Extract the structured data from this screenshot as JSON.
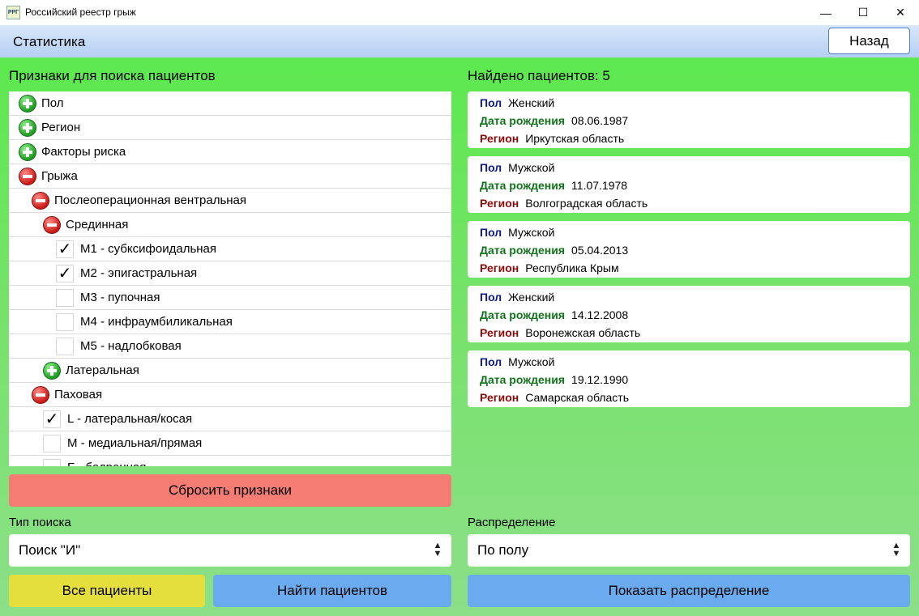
{
  "window": {
    "icon_text": "РРГ",
    "title": "Российский реестр грыж",
    "minimize_glyph": "—",
    "maximize_glyph": "☐",
    "close_glyph": "✕"
  },
  "header": {
    "title": "Статистика",
    "back_label": "Назад"
  },
  "left": {
    "section_title": "Признаки для поиска пациентов",
    "tree": [
      {
        "label": "Пол",
        "type": "plus"
      },
      {
        "label": "Регион",
        "type": "plus"
      },
      {
        "label": "Факторы риска",
        "type": "plus"
      },
      {
        "label": "Грыжа",
        "type": "minus"
      },
      {
        "label": "Послеоперационная вентральная",
        "type": "minus"
      },
      {
        "label": "Срединная",
        "type": "minus"
      },
      {
        "label": "M1 - субксифоидальная",
        "type": "check",
        "checked": true
      },
      {
        "label": "M2 - эпигастральная",
        "type": "check",
        "checked": true
      },
      {
        "label": "M3 - пупочная",
        "type": "check",
        "checked": false
      },
      {
        "label": "M4 - инфраумбиликальная",
        "type": "check",
        "checked": false
      },
      {
        "label": "M5 - надлобковая",
        "type": "check",
        "checked": false
      },
      {
        "label": "Латеральная",
        "type": "plus"
      },
      {
        "label": "Паховая",
        "type": "minus"
      },
      {
        "label": "L - латеральная/косая",
        "type": "check",
        "checked": true
      },
      {
        "label": "M - медиальная/прямая",
        "type": "check",
        "checked": false
      },
      {
        "label": "F - бедренная",
        "type": "check",
        "checked": false
      }
    ],
    "reset_label": "Сбросить признаки",
    "search_type_label": "Тип поиска",
    "search_type_value": "Поиск \"И\"",
    "all_patients_label": "Все пациенты",
    "find_patients_label": "Найти пациентов"
  },
  "right": {
    "found_label": "Найдено пациентов: 5",
    "field_labels": {
      "sex": "Пол",
      "birth": "Дата рождения",
      "region": "Регион"
    },
    "patients": [
      {
        "sex": "Женский",
        "birth": "08.06.1987",
        "region": "Иркутская область"
      },
      {
        "sex": "Мужской",
        "birth": "11.07.1978",
        "region": "Волгоградская область"
      },
      {
        "sex": "Мужской",
        "birth": "05.04.2013",
        "region": "Республика Крым"
      },
      {
        "sex": "Женский",
        "birth": "14.12.2008",
        "region": "Воронежская область"
      },
      {
        "sex": "Мужской",
        "birth": "19.12.1990",
        "region": "Самарская область"
      }
    ],
    "distribution_label": "Распределение",
    "distribution_value": "По полу",
    "show_distribution_label": "Показать распределение"
  },
  "colors": {
    "header_bg": "#b6cff5",
    "panel_bg": "#5de94f",
    "reset_button": "#f47c72",
    "all_button": "#e5df3e",
    "find_button": "#6aabf0",
    "plus_icon": "#1f9c22",
    "minus_icon": "#c81a16"
  }
}
